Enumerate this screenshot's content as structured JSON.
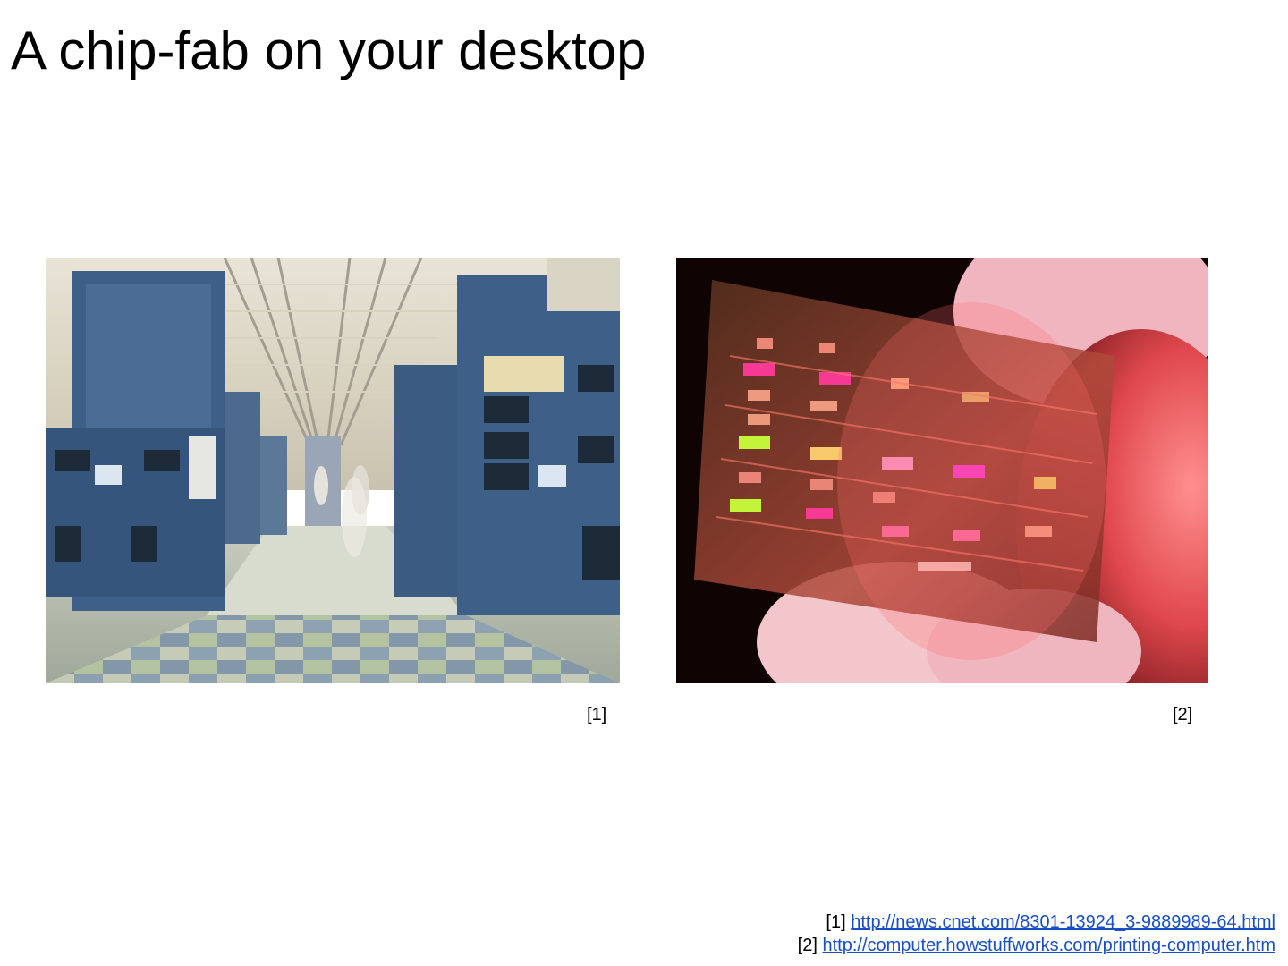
{
  "slide": {
    "title": "A chip-fab on your desktop"
  },
  "figures": [
    {
      "icon": "chip-fab-cleanroom-photo",
      "caption": "[1]"
    },
    {
      "icon": "printed-circuit-on-fingertip-photo",
      "caption": "[2]"
    }
  ],
  "references": [
    {
      "marker": "[1]",
      "url": "http://news.cnet.com/8301-13924_3-9889989-64.html"
    },
    {
      "marker": "[2]",
      "url": "http://computer.howstuffworks.com/printing-computer.htm"
    }
  ],
  "colors": {
    "link": "#1a4fc4",
    "background": "#ffffff",
    "text": "#000000"
  }
}
